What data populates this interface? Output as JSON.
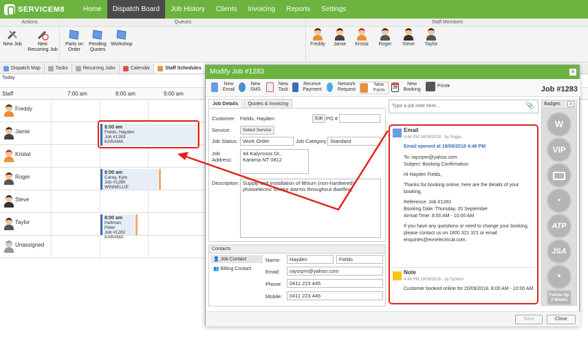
{
  "nav": {
    "brand": "SERVICEM8",
    "items": [
      "Home",
      "Dispatch Board",
      "Job History",
      "Clients",
      "Invoicing",
      "Reports",
      "Settings"
    ]
  },
  "ribbon": {
    "actions_title": "Actions",
    "queues_title": "Queues",
    "staff_title": "Staff Members",
    "new_job": "New Job",
    "new_recurring": "New Recurring Job",
    "parts": "Parts on Order",
    "pending": "Pending Quotes",
    "workshop": "Workshop",
    "staff": [
      "Freddy",
      "Jamie",
      "Kristal",
      "Roger",
      "Steve",
      "Taylor"
    ]
  },
  "tabs": [
    "Dispatch Map",
    "Tasks",
    "Recurring Jobs",
    "Calendar",
    "Staff Schedules"
  ],
  "schedule": {
    "today": "Today",
    "staff_col": "Staff",
    "times": [
      "7:00 am",
      "8:00 am",
      "9:00 am"
    ],
    "rows": [
      "Freddy",
      "Jamie",
      "Kristal",
      "Roger",
      "Steve",
      "Taylor",
      "Unassigned"
    ],
    "jobs": [
      {
        "time": "8:00 am",
        "name": "Fields, Hayden",
        "job": "Job #1283",
        "loc": "KARAMA"
      },
      {
        "time": "8:00 am",
        "name": "Carey, Kyle",
        "job": "Job #1280",
        "loc": "WINNELLIE"
      },
      {
        "time": "8:00 am",
        "name": "Hellman, Peter",
        "job": "Job #1282",
        "loc": "KARAMA"
      }
    ]
  },
  "modal": {
    "title": "Modify Job #1283",
    "job_no": "Job #1283",
    "toolbar": {
      "email": "New Email",
      "sms": "New SMS",
      "task": "New Task",
      "payment": "Receive Payment",
      "network": "Network Request",
      "form": "New Form",
      "booking": "New Booking",
      "print": "Print",
      "cal_day": "26"
    },
    "subtabs": [
      "Job Details",
      "Quotes & Invoicing"
    ],
    "form": {
      "customer_label": "Customer:",
      "customer": "Fields, Hayden",
      "edit": "Edit",
      "po_label": "PO #",
      "service_label": "Service:",
      "select_service": "Select Service",
      "status_label": "Job Status:",
      "status": "Work Order",
      "category_label": "Job Category",
      "category": "Standard",
      "address_label": "Job Address:",
      "address1": "44 Kalymnos Dr,",
      "address2": "Karama NT 0812",
      "desc_label": "Description:",
      "desc": "Supply and installation of lithium (non-hardwired) photoelectric smoke alarms throughout dwelling."
    },
    "contacts": {
      "title": "Contacts",
      "job_contact": "Job Contact",
      "billing_contact": "Billing Contact",
      "name_label": "Name:",
      "first": "Hayden",
      "last": "Fields",
      "email_label": "Email:",
      "email": "raysrpm@yahoo.com",
      "phone_label": "Phone:",
      "phone": "0411 223 445",
      "mobile_label": "Mobile:",
      "mobile": "0411 223 445"
    },
    "note_placeholder": "Type a job note here...",
    "feed": {
      "email_title": "Email",
      "email_meta": "4:44 PM 18/09/2018 · by Roger",
      "email_opened": "Email opened at 18/09/2018 4:46 PM",
      "to": "To: raysrpm@yahoo.com",
      "subject": "Subject: Booking Confirmation",
      "hi": "Hi Hayden Fields,",
      "p1": "Thanks for booking online, here are the details of your booking,",
      "ref": "Reference: Job #1283",
      "date": "Booking Date: Thursday, 20 September",
      "arrival": "Arrival Time: 8:00 AM - 10:00 AM",
      "p2": "If you have any questions or need to change your booking, please contact us on 1800 321 321 or email enquiries@evnelectrical.com.",
      "note_title": "Note",
      "note_meta": "4:44 PM 18/09/2018 · by System",
      "note_text": "Customer booked online for 20/09/2018, 8:00 AM - 10:00 AM"
    },
    "badges": {
      "title": "Badges",
      "items": [
        "W",
        "VIP",
        "",
        "",
        "ATP",
        "JSA",
        ""
      ],
      "follow": "Follow Up 2 Weeks"
    },
    "save": "Save",
    "close": "Close"
  },
  "colors": {
    "green": "#6cb33f",
    "red": "#e2231a",
    "blue": "#3b6fb6"
  }
}
